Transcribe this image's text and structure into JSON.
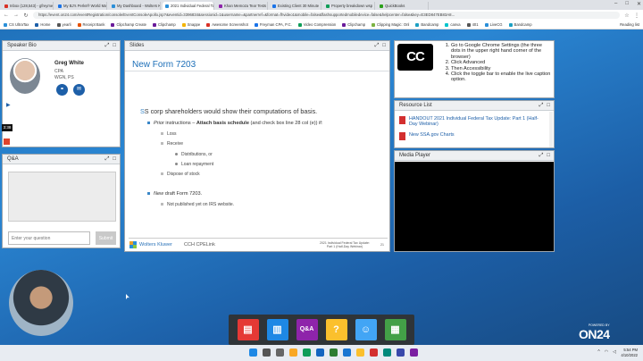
{
  "browser": {
    "tabs": [
      {
        "label": "Inbox (128,543) - gfreyme",
        "color": "#d93025"
      },
      {
        "label": "My BJ's Perks® World Mast",
        "color": "#1a73e8"
      },
      {
        "label": "My Dashboard - Wolters K",
        "color": "#2a8fd8"
      },
      {
        "label": "2021 Individual Federal Ta",
        "color": "#2a8fd8",
        "active": true
      },
      {
        "label": "Khan Memoza Tear Tests",
        "color": "#8e24aa"
      },
      {
        "label": "Existing Client 30 Minute",
        "color": "#1a73e8"
      },
      {
        "label": "Property breakdown wsp",
        "color": "#0f9d58"
      },
      {
        "label": "QuickBooks",
        "color": "#2ca01c"
      }
    ],
    "url": "https://event.on24.com/eventRegistration/console/EventConsoleApollo.jsp?&eventid=3396834&sessionid=1&username=&partnerref=&format=fhvideo1&mobile=false&flashsupportedmobiledevice=false&helpcenter=false&key=E3ED847EB83A8...",
    "bookmarks": [
      {
        "label": "CS UltraTax",
        "color": "#2a8fd8"
      },
      {
        "label": "Home",
        "color": "#1d5fa8"
      },
      {
        "label": "yearli",
        "color": "#555"
      },
      {
        "label": "Receipt Bank",
        "color": "#e65100"
      },
      {
        "label": "Clipchamp Create",
        "color": "#6a1b9a"
      },
      {
        "label": "Clipchamp",
        "color": "#6a1b9a"
      },
      {
        "label": "Snappe",
        "color": "#f4b400"
      },
      {
        "label": "Awesome Screenshot",
        "color": "#d93025"
      },
      {
        "label": "Freyman CPA, P.C.",
        "color": "#1a73e8"
      },
      {
        "label": "Video Compression",
        "color": "#0f9d58"
      },
      {
        "label": "Clipchamp",
        "color": "#6a1b9a"
      },
      {
        "label": "Clipping Magic: Onl",
        "color": "#7cb342"
      },
      {
        "label": "Bandcamp",
        "color": "#1da0c3"
      },
      {
        "label": "canva",
        "color": "#00c4cc"
      },
      {
        "label": "401",
        "color": "#555"
      },
      {
        "label": "LiveCG",
        "color": "#2a8fd8"
      },
      {
        "label": "Bandcamp",
        "color": "#1da0c3"
      }
    ],
    "reading_list": "Reading list"
  },
  "speaker_bio": {
    "title": "Speaker Bio",
    "name": "Greg White",
    "cred1": "CPA",
    "cred2": "WGN, PS",
    "time": "3:38"
  },
  "qa": {
    "title": "Q&A",
    "input_placeholder": "Enter your question",
    "submit_label": "Submit"
  },
  "slides": {
    "title": "Slides",
    "slide_title": "New Form 7203",
    "bullet_main": "S corp shareholders would show their computations of basis.",
    "prior_prefix": "Prior",
    "prior_text": " instructions – ",
    "prior_bold": "Attach basis schedule",
    "prior_tail": " (and check box line 28 col (e)) if:",
    "loss": "Loss",
    "receive": "Receive",
    "distributions": "Distributions, or",
    "loan": "Loan repayment",
    "dispose": "Dispose of stock",
    "new_prefix": "New",
    "new_text": " draft Form 7203.",
    "not_published": "Not published yet on IRS website.",
    "footer_brand": "Wolters Kluwer",
    "footer_cpe": "CCH CPELink",
    "footer_r1": "2021 Individual Federal Tax Update:",
    "footer_r2": "Part 1 (Half-Day Webinar)",
    "page_number": "21"
  },
  "cc": {
    "logo": "CC",
    "steps": [
      "Go to Google Chrome Settings (the three dots in the upper right hand corner of the browser)",
      "Click Advanced",
      "Then Accessibility",
      "Click the toggle bar to enable the live caption option."
    ]
  },
  "resources": {
    "title": "Resource List",
    "items": [
      "HANDOUT 2021 Individual Federal Tax Update: Part 1 (Half-Day Webinar)",
      "New SSA.gov Charts"
    ]
  },
  "media": {
    "title": "Media Player"
  },
  "dock": [
    {
      "name": "slides",
      "color": "#e53935",
      "glyph": "▤"
    },
    {
      "name": "speaker",
      "color": "#1e88e5",
      "glyph": "▥"
    },
    {
      "name": "qa",
      "color": "#8e24aa",
      "glyph": "Q&A"
    },
    {
      "name": "help",
      "color": "#fbc02d",
      "glyph": "?"
    },
    {
      "name": "bio",
      "color": "#42a5f5",
      "glyph": "☺"
    },
    {
      "name": "resources",
      "color": "#43a047",
      "glyph": "▦"
    }
  ],
  "on24": {
    "powered": "POWERED BY",
    "logo": "ON24"
  },
  "taskbar": {
    "time": "5:54 PM",
    "date": "4/10/2022"
  }
}
